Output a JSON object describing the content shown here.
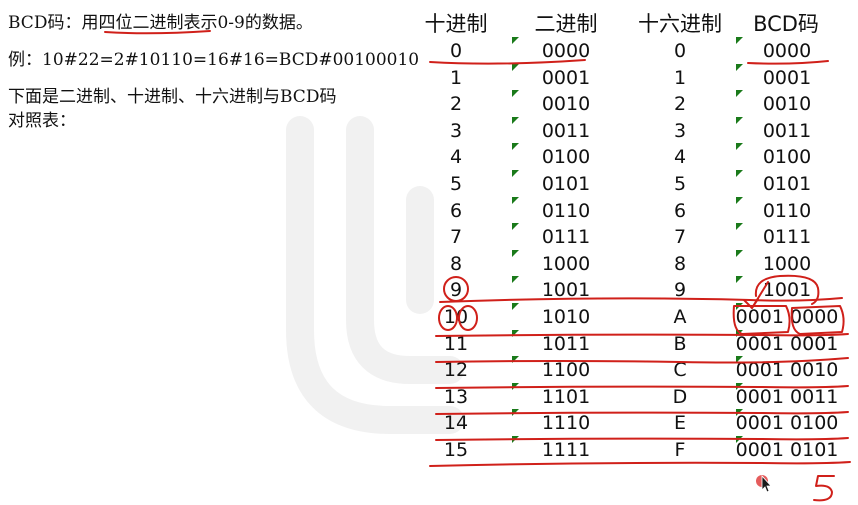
{
  "intro": {
    "line1": "BCD码：用四位二进制表示0-9的数据。",
    "line2": "例：10#22=2#10110=16#16=BCD#00100010",
    "line3": "下面是二进制、十进制、十六进制与BCD码",
    "line4": "对照表："
  },
  "table": {
    "headers": {
      "dec": "十进制",
      "bin": "二进制",
      "hex": "十六进制",
      "bcd": "BCD码"
    },
    "rows": [
      {
        "dec": "0",
        "bin": "0000",
        "hex": "0",
        "bcd": "0000"
      },
      {
        "dec": "1",
        "bin": "0001",
        "hex": "1",
        "bcd": "0001"
      },
      {
        "dec": "2",
        "bin": "0010",
        "hex": "2",
        "bcd": "0010"
      },
      {
        "dec": "3",
        "bin": "0011",
        "hex": "3",
        "bcd": "0011"
      },
      {
        "dec": "4",
        "bin": "0100",
        "hex": "4",
        "bcd": "0100"
      },
      {
        "dec": "5",
        "bin": "0101",
        "hex": "5",
        "bcd": "0101"
      },
      {
        "dec": "6",
        "bin": "0110",
        "hex": "6",
        "bcd": "0110"
      },
      {
        "dec": "7",
        "bin": "0111",
        "hex": "7",
        "bcd": "0111"
      },
      {
        "dec": "8",
        "bin": "1000",
        "hex": "8",
        "bcd": "1000"
      },
      {
        "dec": "9",
        "bin": "1001",
        "hex": "9",
        "bcd": "1001"
      },
      {
        "dec": "10",
        "bin": "1010",
        "hex": "A",
        "bcd": "0001 0000"
      },
      {
        "dec": "11",
        "bin": "1011",
        "hex": "B",
        "bcd": "0001 0001"
      },
      {
        "dec": "12",
        "bin": "1100",
        "hex": "C",
        "bcd": "0001 0010"
      },
      {
        "dec": "13",
        "bin": "1101",
        "hex": "D",
        "bcd": "0001 0011"
      },
      {
        "dec": "14",
        "bin": "1110",
        "hex": "E",
        "bcd": "0001 0100"
      },
      {
        "dec": "15",
        "bin": "1111",
        "hex": "F",
        "bcd": "0001 0101"
      }
    ]
  },
  "colors": {
    "ink": "#d0201a",
    "flag": "#1a7a1a",
    "watermark": "#f2f2f2"
  },
  "icons": {
    "cursor": "pointer-cursor-icon",
    "cell_flag": "green-corner-flag-icon"
  }
}
